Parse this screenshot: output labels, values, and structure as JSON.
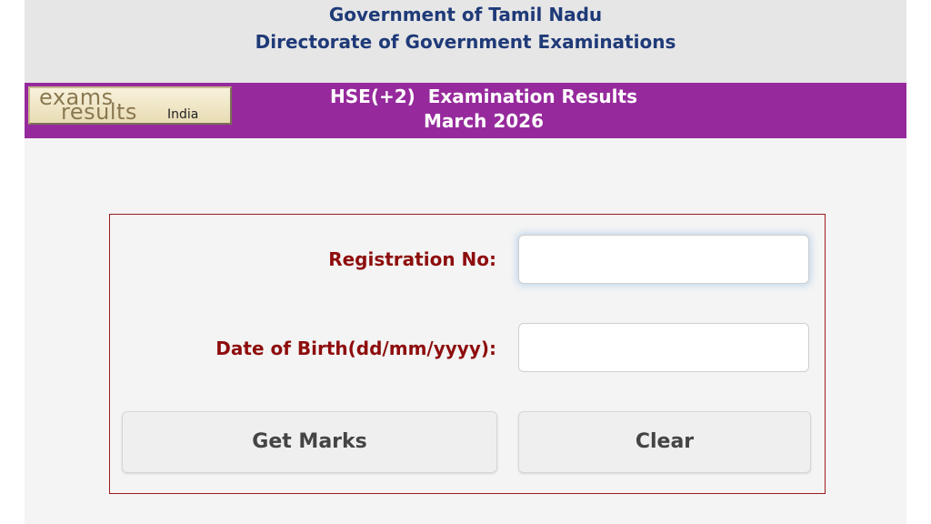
{
  "header": {
    "line1": "Government of Tamil Nadu",
    "line2": "Directorate of Government Examinations",
    "background": "#e6e6e6",
    "text_color": "#1f3a78"
  },
  "banner": {
    "logo": {
      "word1": "exams",
      "word2": "results",
      "word3": "India"
    },
    "title_line1": "HSE(+2)  Examination Results",
    "title_line2": "March 2026",
    "background": "#962a9c"
  },
  "form": {
    "registration_label": "Registration No:",
    "registration_value": "",
    "dob_label": "Date of Birth(dd/mm/yyyy):",
    "dob_value": "",
    "get_marks_label": "Get Marks",
    "clear_label": "Clear",
    "label_color": "#8e0d0d",
    "border_color": "#9d1a1a"
  }
}
